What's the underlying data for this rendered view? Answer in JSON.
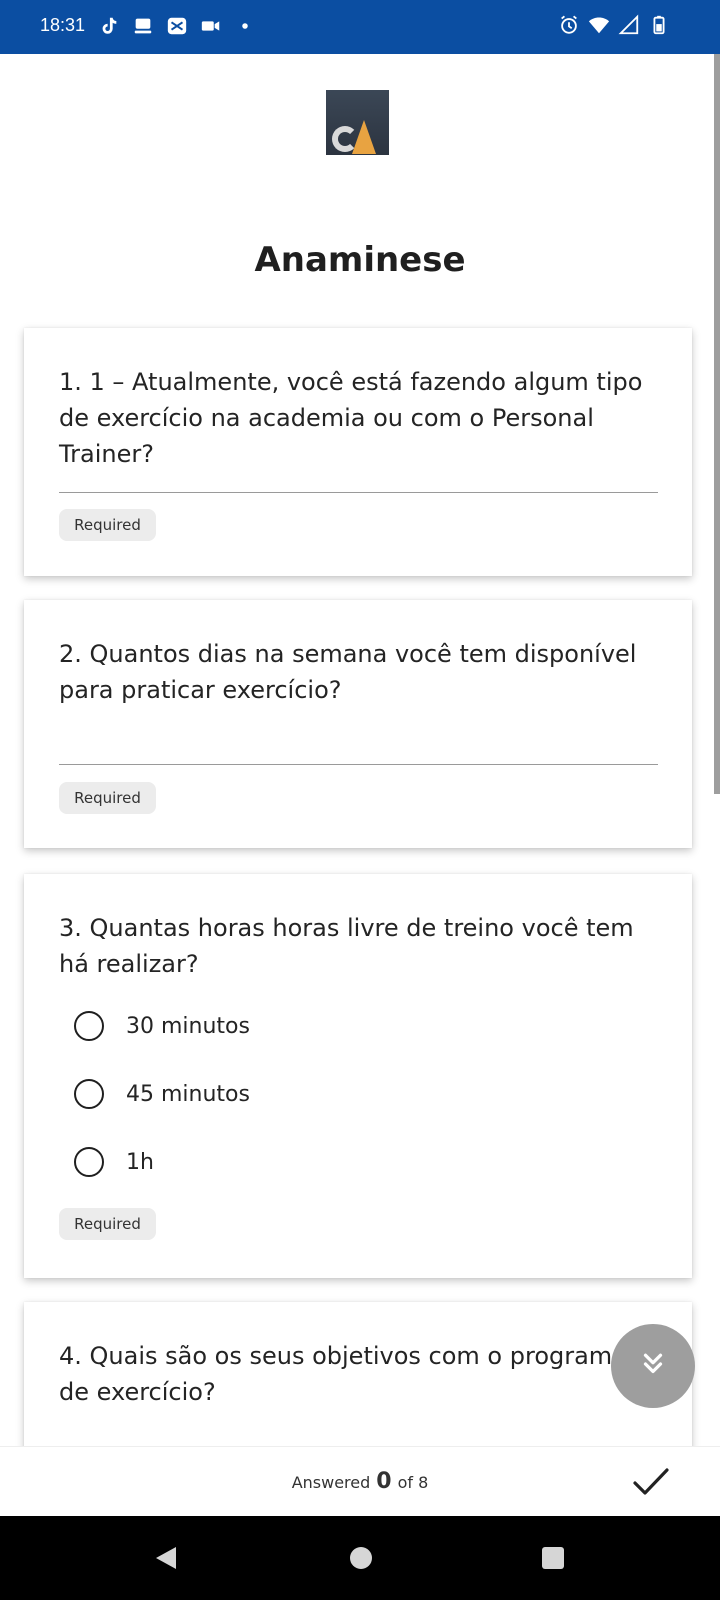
{
  "status_bar": {
    "time": "18:31",
    "left_icons": [
      "tiktok-icon",
      "cloud-stack-icon",
      "capcut-icon",
      "video-camera-icon",
      "dot-icon"
    ],
    "right_icons": [
      "alarm-icon",
      "wifi-icon",
      "signal-icon",
      "battery-icon"
    ]
  },
  "header": {
    "title": "Anaminese"
  },
  "questions": [
    {
      "label": "1. 1 – Atualmente, você está fazendo algum tipo de exercício na academia ou com o Personal Trainer?",
      "required": "Required"
    },
    {
      "label": "2. Quantos dias na semana você tem disponível para praticar exercício?",
      "required": "Required"
    },
    {
      "label": "3. Quantas horas horas livre de treino você tem há realizar?",
      "options": [
        "30 minutos",
        "45 minutos",
        "1h"
      ],
      "required": "Required"
    },
    {
      "label": "4. Quais são os seus objetivos com o programa de exercício?"
    }
  ],
  "footer": {
    "answered_label": "Answered",
    "answered_count": "0",
    "total_label": "of 8"
  },
  "colors": {
    "status_bar": "#0b4ea2",
    "fab": "#9e9e9e",
    "required_bg": "#ececec"
  }
}
